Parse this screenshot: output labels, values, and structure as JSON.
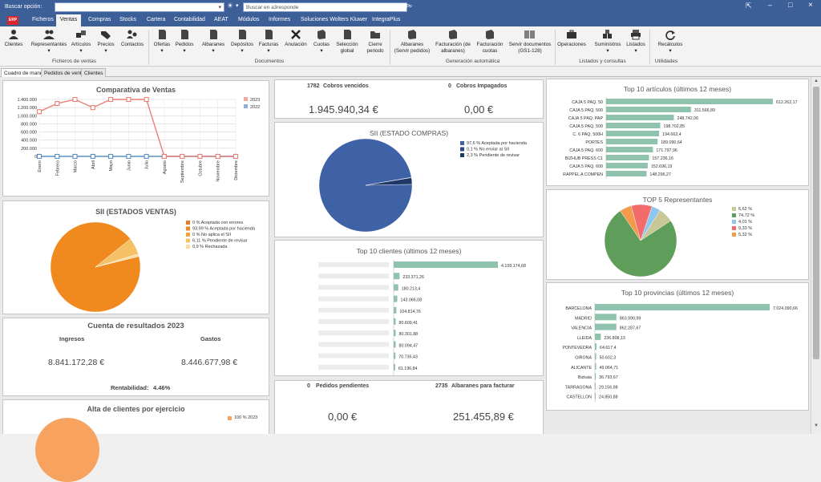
{
  "titlebar": {
    "search_label": "Buscar opción:",
    "search_placeholder": "Buscar en a3responde",
    "app_title": "a3ERP"
  },
  "menu": [
    "Ficheros",
    "Ventas",
    "Compras",
    "Stocks",
    "Cartera",
    "Contabilidad",
    "AEAT",
    "Módulos",
    "Informes",
    "Soluciones Wolters Kluwer",
    "IntegraPlus"
  ],
  "menu_active": "Ventas",
  "ribbon": {
    "buttons": [
      {
        "label": "Clientes",
        "icon": "person-icon"
      },
      {
        "label": "Representantes",
        "icon": "people-icon"
      },
      {
        "label": "Artículos",
        "icon": "articles-icon"
      },
      {
        "label": "Precios",
        "icon": "tags-icon"
      },
      {
        "label": "Contactos",
        "icon": "contacts-icon"
      },
      {
        "label": "Ofertas",
        "icon": "doc-icon"
      },
      {
        "label": "Pedidos",
        "icon": "doc-icon"
      },
      {
        "label": "Albaranes",
        "icon": "doc-icon"
      },
      {
        "label": "Depósitos",
        "icon": "doc-icon"
      },
      {
        "label": "Facturas",
        "icon": "doc-icon"
      },
      {
        "label": "Anulación",
        "icon": "x-icon"
      },
      {
        "label": "Cuotas",
        "icon": "stack-icon"
      },
      {
        "label": "Selección global",
        "icon": "doc-icon"
      },
      {
        "label": "Cierre periodo",
        "icon": "folder-icon"
      },
      {
        "label": "Albaranes (Servir pedidos)",
        "icon": "stack-icon"
      },
      {
        "label": "Facturación (de albaranes)",
        "icon": "stack-icon"
      },
      {
        "label": "Facturación cuotas",
        "icon": "stack-icon"
      },
      {
        "label": "Servir documentos (GS1-128)",
        "icon": "barcode-icon"
      },
      {
        "label": "Operaciones",
        "icon": "briefcase-icon"
      },
      {
        "label": "Suministros",
        "icon": "boxes-icon"
      },
      {
        "label": "Listados",
        "icon": "printer-icon"
      },
      {
        "label": "Recálculos",
        "icon": "refresh-icon"
      }
    ],
    "groups": [
      "Ficheros de ventas",
      "Documentos",
      "Generación automática",
      "Listados y consultas",
      "Utilidades"
    ]
  },
  "tabs": [
    "Cuadro de mando",
    "Pedidos de venta",
    "Clientes"
  ],
  "comparativa": {
    "title": "Comparativa de Ventas",
    "chart_data": {
      "type": "line",
      "categories": [
        "Enero",
        "Febrero",
        "Marzo",
        "Abril",
        "Mayo",
        "Junio",
        "Julio",
        "Agosto",
        "Septiembre",
        "Octubre",
        "Noviembre",
        "Diciembre"
      ],
      "series": [
        {
          "name": "2023",
          "values": [
            1100000,
            1300000,
            1400000,
            1200000,
            1400000,
            1400000,
            1400000,
            0,
            0,
            0,
            0,
            0
          ],
          "color": "#e8817a"
        },
        {
          "name": "2022",
          "values": [
            0,
            0,
            0,
            0,
            0,
            0,
            0,
            0,
            0,
            0,
            0,
            0
          ],
          "color": "#5b8fc4"
        }
      ],
      "yticks": [
        "1.400.000",
        "1.200.000",
        "1.000.000",
        "800.000",
        "600.000",
        "400.000",
        "200.000",
        "0"
      ],
      "ylim": [
        0,
        1400000
      ]
    }
  },
  "sii_ventas": {
    "title": "SII (ESTADOS VENTAS)",
    "chart_data": {
      "type": "pie",
      "slices": [
        {
          "label": "0 % Aceptada con errores",
          "value": 0,
          "color": "#e07f2a"
        },
        {
          "label": "93,99 % Aceptada por hacienda",
          "value": 93.99,
          "color": "#f08a1f"
        },
        {
          "label": "0 % No aplica el SII",
          "value": 0,
          "color": "#f5a23a"
        },
        {
          "label": "6,11 % Pendiente de revisar",
          "value": 6.11,
          "color": "#f6c166"
        },
        {
          "label": "0,9 % Rechazada",
          "value": 0.9,
          "color": "#f7dda0"
        }
      ]
    }
  },
  "resultados": {
    "title": "Cuenta de resultados 2023",
    "ingresos_label": "Ingresos",
    "gastos_label": "Gastos",
    "ingresos": "8.841.172,28 €",
    "gastos": "8.446.677,98 €",
    "rent_label": "Rentabilidad:",
    "rent_value": "4.46%"
  },
  "alta": {
    "title": "Alta de clientes por ejercicio",
    "legend": "100 % 2023"
  },
  "cobros": {
    "vencidos_count": "1782",
    "vencidos_label": "Cobros vencidos",
    "impagados_count": "0",
    "impagados_label": "Cobros Impagados",
    "vencidos_value": "1.945.940,34 €",
    "impagados_value": "0,00 €"
  },
  "sii_compras": {
    "title": "SII (ESTADO COMPRAS)",
    "chart_data": {
      "type": "pie",
      "slices": [
        {
          "label": "97,6 % Aceptada por hacienda",
          "value": 97.6,
          "color": "#3f62a6"
        },
        {
          "label": "0,1 % No enviar al SII",
          "value": 0.1,
          "color": "#2a4a86"
        },
        {
          "label": "2,3 % Pendiente de revisar",
          "value": 2.3,
          "color": "#1e3766"
        }
      ]
    }
  },
  "top_clientes": {
    "title": "Top 10 clientes (últimos 12 meses)",
    "chart_data": {
      "type": "bar",
      "orientation": "horizontal",
      "values": [
        4109174.68,
        233371.26,
        180213.4,
        143066.08,
        104814.76,
        80609.41,
        80301.88,
        80094.47,
        70736.43,
        61196.84
      ],
      "value_labels": [
        "4.109.174,68",
        "233.371,26",
        "180.213,4",
        "143.066,08",
        "104.814,76",
        "80.609,41",
        "80.301,88",
        "80.094,47",
        "70.736,43",
        "61.196,84"
      ]
    }
  },
  "pedidos": {
    "pend_count": "0",
    "pend_label": "Pedidos pendientes",
    "alb_count": "2735",
    "alb_label": "Albaranes para facturar",
    "pend_value": "0,00 €",
    "alb_value": "251.455,89 €"
  },
  "top_articulos": {
    "title": "Top 10 artículos (últimos 12 meses)",
    "chart_data": {
      "type": "bar",
      "orientation": "horizontal",
      "categories": [
        "CAJA 5 PAQ. 50",
        "CAJA 5 PAQ. 500",
        "CAJA 5 PAQ. PAP",
        "CAJA 5 PAQ. 500",
        "C. 6 PAQ. 500H",
        "PORTES",
        "CAJA 5 PAQ. 600",
        "BIZHUB PRESS C1",
        "CAJA 5 PAQ. 600",
        "RAPPEL A COMPEN"
      ],
      "values": [
        612262.17,
        311566.89,
        248742.06,
        198702.85,
        194662.4,
        189090.64,
        171797.96,
        157236.16,
        152696.19,
        148296.27
      ],
      "value_labels": [
        "612.262,17",
        "311.566,89",
        "248.742,06",
        "198.702,85",
        "194.662,4",
        "189.090,64",
        "171.797,96",
        "157.236,16",
        "152.696,19",
        "148.296,27"
      ]
    }
  },
  "top5_rep": {
    "title": "TOP 5 Representantes",
    "chart_data": {
      "type": "pie",
      "slices": [
        {
          "label": "6,62 %",
          "value": 6.62,
          "color": "#c8c896"
        },
        {
          "label": "74,72 %",
          "value": 74.72,
          "color": "#5f9e5a"
        },
        {
          "label": "4,01 %",
          "value": 4.01,
          "color": "#8fc6f0"
        },
        {
          "label": "9,33 %",
          "value": 9.33,
          "color": "#f26c6c"
        },
        {
          "label": "5,32 %",
          "value": 5.32,
          "color": "#f39a4c"
        }
      ]
    }
  },
  "top_provincias": {
    "title": "Top 10 provincias (últimos 12 meses)",
    "chart_data": {
      "type": "bar",
      "orientation": "horizontal",
      "categories": [
        "BARCELONA",
        "MADRID",
        "VALENCIA",
        "LLEIDA",
        "PONTEVEDRA",
        "GIRONA",
        "ALICANTE",
        "Bizkaia",
        "TARRAGONA",
        "CASTELLON"
      ],
      "values": [
        7024090.66,
        863990.99,
        862287.67,
        236808.13,
        64617.4,
        50602.3,
        49064.71,
        36793.67,
        29156.98,
        24850.88
      ],
      "value_labels": [
        "7.024.090,66",
        "863.990,99",
        "862.287,67",
        "236.808,13",
        "64.617,4",
        "50.602,3",
        "49.064,71",
        "36.793,67",
        "29.156,98",
        "24.850,88"
      ]
    }
  },
  "colors": {
    "bar": "#8fc3ad",
    "titlebar": "#3d5f97"
  }
}
